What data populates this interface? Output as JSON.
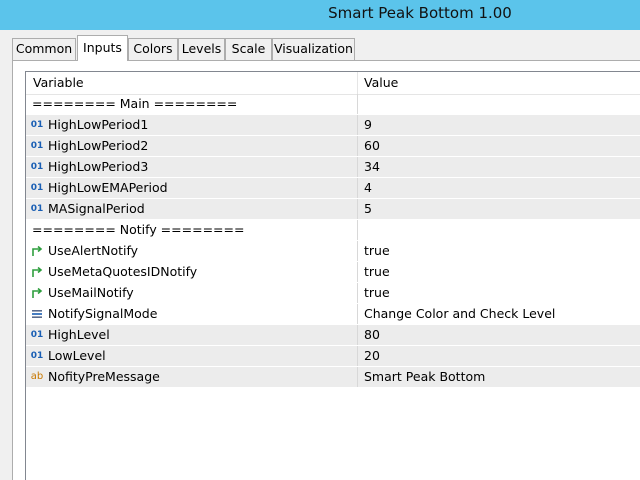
{
  "window": {
    "title": "Smart Peak Bottom 1.00"
  },
  "tabs": [
    "Common",
    "Inputs",
    "Colors",
    "Levels",
    "Scale",
    "Visualization"
  ],
  "active_tab": "Inputs",
  "grid": {
    "header": {
      "variable": "Variable",
      "value": "Value"
    },
    "rows": [
      {
        "icon": "none",
        "name": "======== Main ========",
        "value": ""
      },
      {
        "icon": "int-icon",
        "icon_text": "01",
        "name": "HighLowPeriod1",
        "value": "9"
      },
      {
        "icon": "int-icon",
        "icon_text": "01",
        "name": "HighLowPeriod2",
        "value": "60"
      },
      {
        "icon": "int-icon",
        "icon_text": "01",
        "name": "HighLowPeriod3",
        "value": "34"
      },
      {
        "icon": "int-icon",
        "icon_text": "01",
        "name": "HighLowEMAPeriod",
        "value": "4"
      },
      {
        "icon": "int-icon",
        "icon_text": "01",
        "name": "MASignalPeriod",
        "value": "5"
      },
      {
        "icon": "none",
        "name": "======== Notify ========",
        "value": ""
      },
      {
        "icon": "bool-icon",
        "name": "UseAlertNotify",
        "value": "true"
      },
      {
        "icon": "bool-icon",
        "name": "UseMetaQuotesIDNotify",
        "value": "true"
      },
      {
        "icon": "bool-icon",
        "name": "UseMailNotify",
        "value": "true"
      },
      {
        "icon": "enum-icon",
        "name": "NotifySignalMode",
        "value": "Change Color and Check Level"
      },
      {
        "icon": "int-icon",
        "icon_text": "01",
        "name": "HighLevel",
        "value": "80"
      },
      {
        "icon": "int-icon",
        "icon_text": "01",
        "name": "LowLevel",
        "value": "20"
      },
      {
        "icon": "string-icon",
        "icon_text": "ab",
        "name": "NofityPreMessage",
        "value": "Smart Peak Bottom"
      }
    ]
  },
  "colors": {
    "titlebar": "#5bc4eb",
    "int_icon": "#1a5fb4",
    "bool_icon": "#2e9e3e",
    "string_icon": "#c87800"
  }
}
